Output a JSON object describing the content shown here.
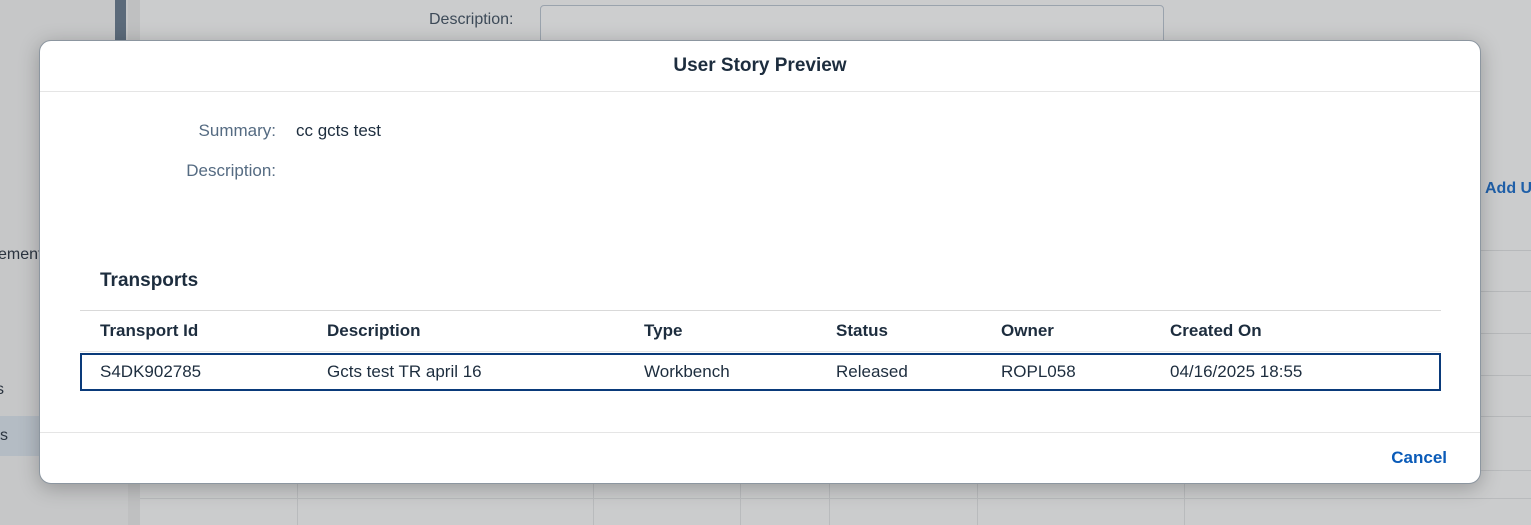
{
  "background": {
    "nav_items": [
      {
        "label": "ement"
      },
      {
        "label": "s"
      },
      {
        "label": "s"
      }
    ],
    "description_label": "Description:",
    "add_link": "Add U"
  },
  "dialog": {
    "title": "User Story Preview",
    "summary_label": "Summary:",
    "summary_value": "cc gcts test",
    "description_label": "Description:",
    "description_value": "",
    "transports_title": "Transports",
    "columns": [
      "Transport Id",
      "Description",
      "Type",
      "Status",
      "Owner",
      "Created On"
    ],
    "rows": [
      {
        "transport_id": "S4DK902785",
        "description": "Gcts test TR april 16",
        "type": "Workbench",
        "status": "Released",
        "owner": "ROPL058",
        "created_on": "04/16/2025 18:55"
      }
    ],
    "cancel_label": "Cancel"
  },
  "colors": {
    "accent": "#0a5bb8",
    "selected_row_border": "#0a3a7a",
    "text": "#1d2d3e",
    "label": "#556b82"
  }
}
